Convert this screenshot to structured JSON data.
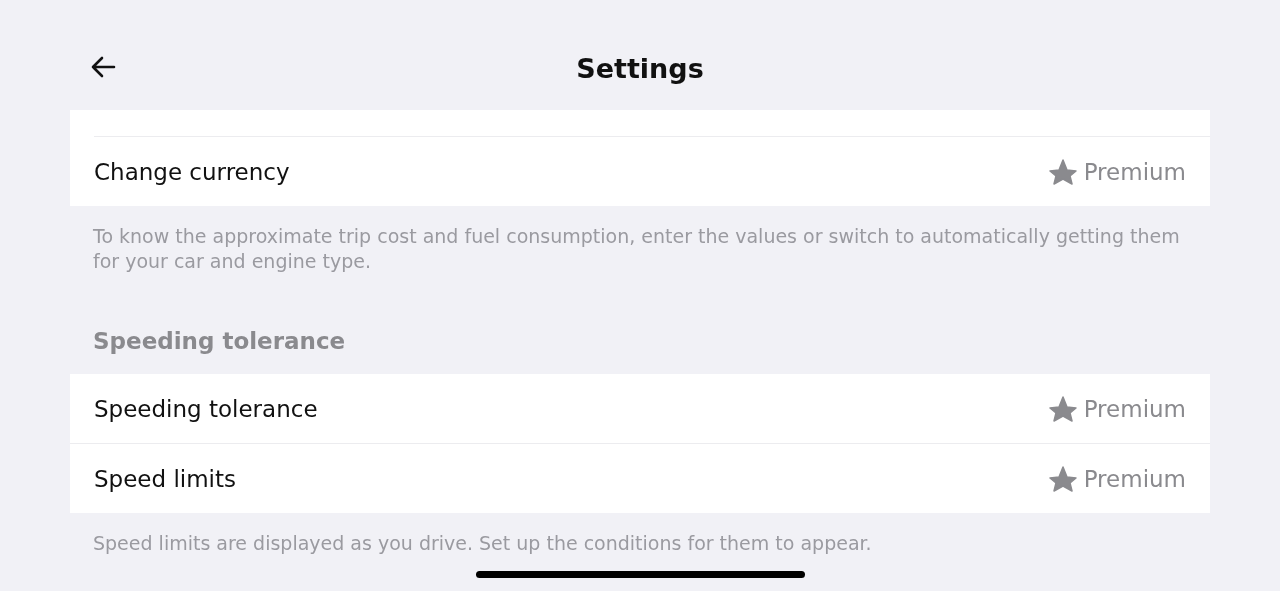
{
  "header": {
    "title": "Settings"
  },
  "sections": [
    {
      "rows": [
        {
          "kind": "hidden"
        },
        {
          "kind": "premium",
          "label": "Change currency",
          "badge": "Premium"
        }
      ],
      "note": "To know the approximate trip cost and fuel consumption, enter the values or switch to automatically getting them for your car and engine type."
    },
    {
      "heading": "Speeding tolerance",
      "rows": [
        {
          "kind": "premium",
          "label": "Speeding tolerance",
          "badge": "Premium"
        },
        {
          "kind": "premium",
          "label": "Speed limits",
          "badge": "Premium"
        }
      ],
      "note": "Speed limits are displayed as you drive. Set up the conditions for them to appear."
    }
  ]
}
